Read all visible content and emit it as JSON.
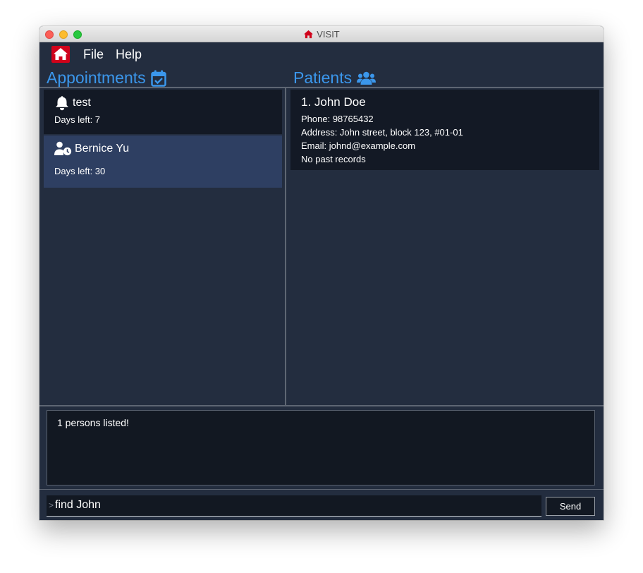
{
  "window": {
    "title": "VISIT",
    "logo_icon": "house-icon",
    "logo_color": "#d0021b"
  },
  "menu": {
    "items": [
      {
        "label": "File"
      },
      {
        "label": "Help"
      }
    ]
  },
  "appointments_panel": {
    "title": "Appointments",
    "icon": "calendar-check-icon",
    "items": [
      {
        "name": "test",
        "icon": "bell-icon",
        "days_left": "Days left: 7",
        "selected": false
      },
      {
        "name": "Bernice Yu",
        "icon": "user-clock-icon",
        "days_left": "Days left: 30",
        "selected": true
      }
    ]
  },
  "patients_panel": {
    "title": "Patients",
    "icon": "users-icon",
    "items": [
      {
        "index_name": "1.  John Doe",
        "phone": "Phone: 98765432",
        "address": "Address: John street, block 123, #01-01",
        "email": "Email: johnd@example.com",
        "records": "No past records"
      }
    ]
  },
  "result_display": {
    "text": "1 persons listed!"
  },
  "command_box": {
    "prompt": ">",
    "value": "find John",
    "send_label": "Send"
  },
  "colors": {
    "background": "#232d3f",
    "card_dark": "#131925",
    "card_selected": "#2e3f62",
    "accent": "#3b97ec",
    "logo_red": "#d0021b"
  }
}
